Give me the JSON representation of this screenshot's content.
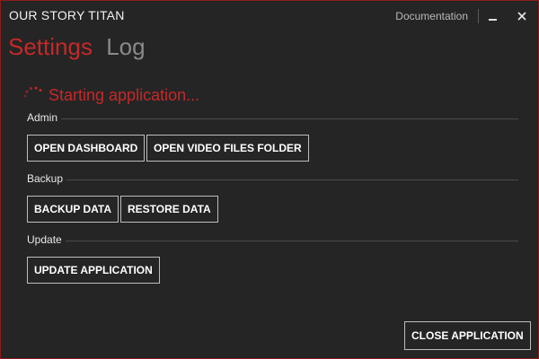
{
  "window": {
    "title": "OUR STORY TITAN",
    "documentation_label": "Documentation"
  },
  "tabs": [
    {
      "label": "Settings",
      "active": true
    },
    {
      "label": "Log",
      "active": false
    }
  ],
  "status": {
    "text": "Starting application..."
  },
  "sections": {
    "admin": {
      "label": "Admin",
      "buttons": [
        "OPEN DASHBOARD",
        "OPEN VIDEO FILES FOLDER"
      ]
    },
    "backup": {
      "label": "Backup",
      "buttons": [
        "BACKUP DATA",
        "RESTORE DATA"
      ]
    },
    "update": {
      "label": "Update",
      "buttons": [
        "UPDATE APPLICATION"
      ]
    }
  },
  "footer": {
    "close_label": "CLOSE APPLICATION"
  },
  "colors": {
    "accent": "#c62828",
    "background": "#252525",
    "border": "#8a1c1c",
    "inactive_tab": "#8a8a8a"
  }
}
